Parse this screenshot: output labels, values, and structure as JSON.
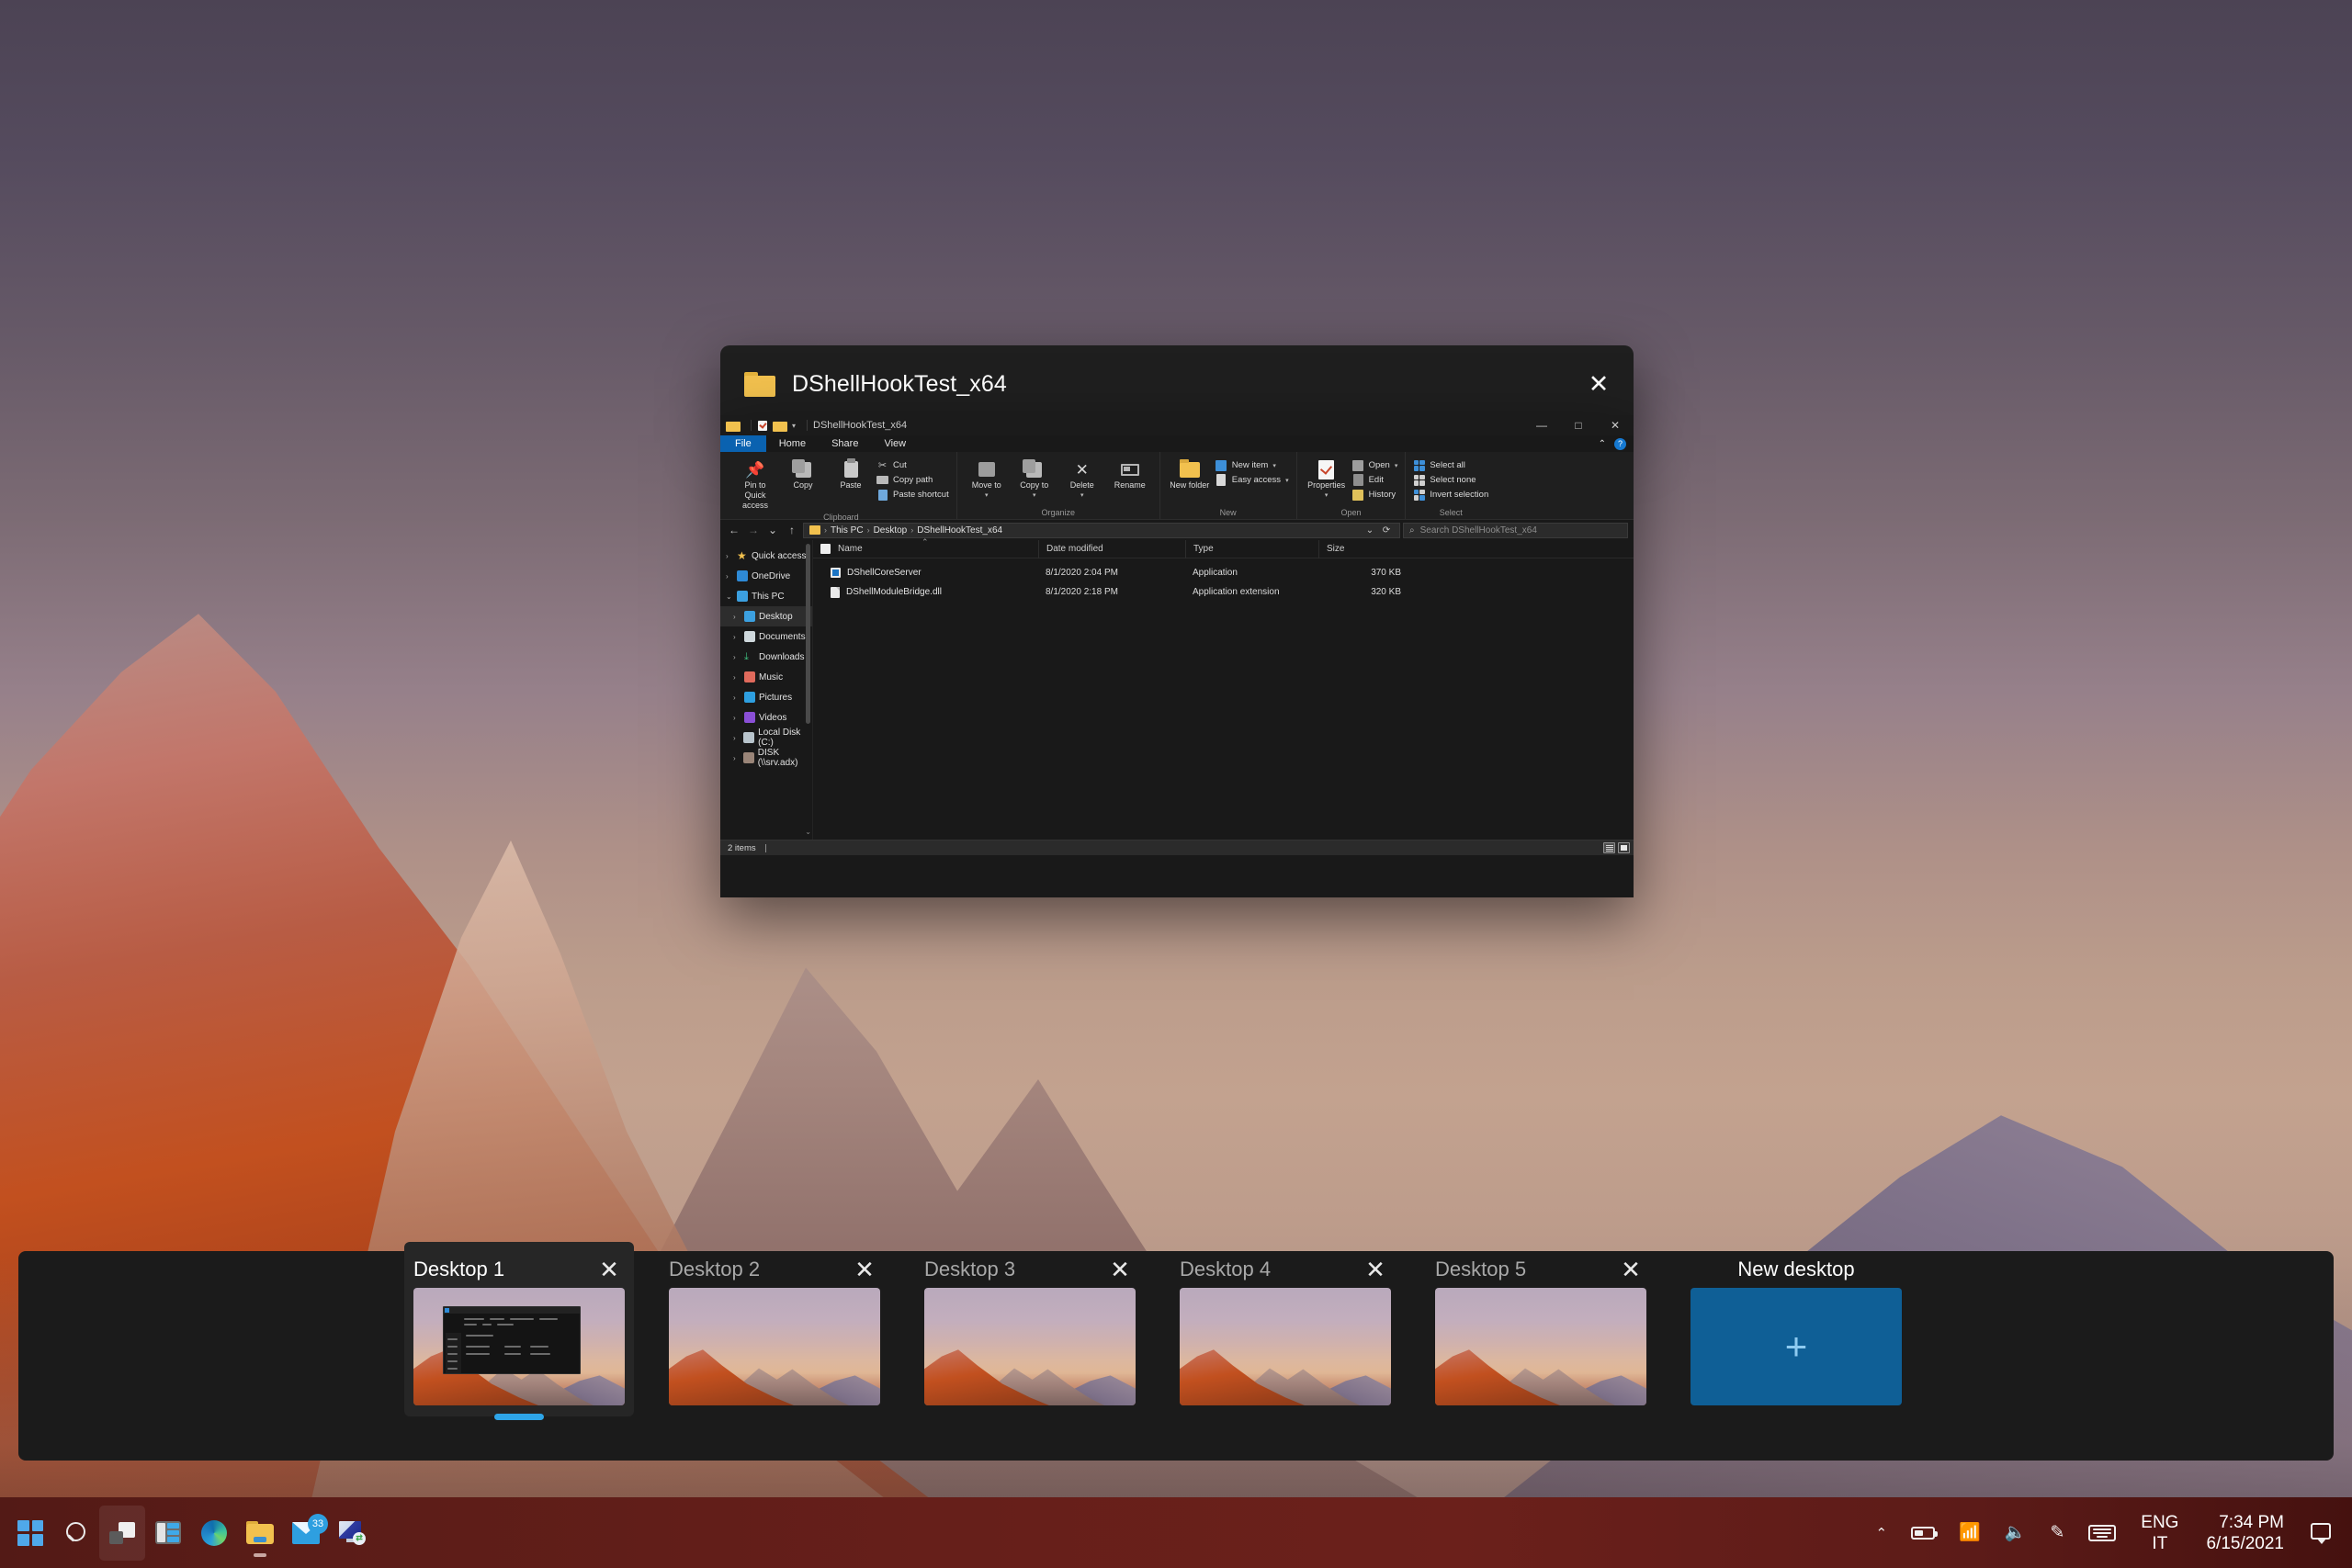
{
  "dialog": {
    "title": "DShellHookTest_x64",
    "folder_icon": "folder-icon",
    "close_icon": "close-icon"
  },
  "explorer": {
    "qat": {
      "title": "DShellHookTest_x64",
      "icons": [
        "folder-icon",
        "properties-check-icon",
        "new-folder-icon"
      ],
      "dropdown_caret": "▾",
      "minimize": "—",
      "maximize": "□",
      "close": "✕"
    },
    "ribbon_tabs": [
      {
        "label": "File",
        "active": true
      },
      {
        "label": "Home",
        "active": false
      },
      {
        "label": "Share",
        "active": false
      },
      {
        "label": "View",
        "active": false
      }
    ],
    "ribbon_collapse_icon": "chevron-up-icon",
    "ribbon_help_label": "?",
    "ribbon_groups": [
      {
        "name": "Clipboard",
        "big_buttons": [
          {
            "label": "Pin to Quick access",
            "icon": "pin-icon"
          },
          {
            "label": "Copy",
            "icon": "copy-icon"
          },
          {
            "label": "Paste",
            "icon": "paste-icon"
          }
        ],
        "small_buttons": [
          {
            "label": "Cut",
            "icon": "scissors-icon"
          },
          {
            "label": "Copy path",
            "icon": "copy-path-icon"
          },
          {
            "label": "Paste shortcut",
            "icon": "paste-shortcut-icon"
          }
        ]
      },
      {
        "name": "Organize",
        "big_buttons": [
          {
            "label": "Move to",
            "icon": "move-to-icon",
            "caret": "▾"
          },
          {
            "label": "Copy to",
            "icon": "copy-to-icon",
            "caret": "▾"
          },
          {
            "label": "Delete",
            "icon": "delete-icon",
            "caret": "▾"
          },
          {
            "label": "Rename",
            "icon": "rename-icon"
          }
        ],
        "small_buttons": []
      },
      {
        "name": "New",
        "big_buttons": [
          {
            "label": "New folder",
            "icon": "new-folder-icon"
          }
        ],
        "small_buttons": [
          {
            "label": "New item",
            "icon": "new-item-icon",
            "caret": "▾"
          },
          {
            "label": "Easy access",
            "icon": "easy-access-icon",
            "caret": "▾"
          }
        ]
      },
      {
        "name": "Open",
        "big_buttons": [
          {
            "label": "Properties",
            "icon": "properties-icon",
            "caret": "▾"
          }
        ],
        "small_buttons": [
          {
            "label": "Open",
            "icon": "open-icon",
            "caret": "▾"
          },
          {
            "label": "Edit",
            "icon": "edit-icon"
          },
          {
            "label": "History",
            "icon": "history-icon"
          }
        ]
      },
      {
        "name": "Select",
        "big_buttons": [],
        "small_buttons": [
          {
            "label": "Select all",
            "icon": "select-all-icon"
          },
          {
            "label": "Select none",
            "icon": "select-none-icon"
          },
          {
            "label": "Invert selection",
            "icon": "invert-selection-icon"
          }
        ]
      }
    ],
    "address_bar": {
      "back_icon": "←",
      "forward_icon": "→",
      "recent_icon": "⌄",
      "up_icon": "↑",
      "breadcrumbs": [
        "This PC",
        "Desktop",
        "DShellHookTest_x64"
      ],
      "dropdown_icon": "⌄",
      "refresh_icon": "⟳"
    },
    "search": {
      "placeholder": "Search DShellHookTest_x64",
      "icon": "search-icon"
    },
    "nav_pane": {
      "items": [
        {
          "label": "Quick access",
          "icon": "star-icon",
          "selected": false,
          "indent": 0
        },
        {
          "label": "OneDrive",
          "icon": "onedrive-icon",
          "selected": false,
          "indent": 0
        },
        {
          "label": "This PC",
          "icon": "this-pc-icon",
          "selected": false,
          "indent": 0,
          "expanded": true
        },
        {
          "label": "Desktop",
          "icon": "desktop-icon",
          "selected": true,
          "indent": 1
        },
        {
          "label": "Documents",
          "icon": "documents-icon",
          "selected": false,
          "indent": 1
        },
        {
          "label": "Downloads",
          "icon": "downloads-icon",
          "selected": false,
          "indent": 1
        },
        {
          "label": "Music",
          "icon": "music-icon",
          "selected": false,
          "indent": 1
        },
        {
          "label": "Pictures",
          "icon": "pictures-icon",
          "selected": false,
          "indent": 1
        },
        {
          "label": "Videos",
          "icon": "videos-icon",
          "selected": false,
          "indent": 1
        },
        {
          "label": "Local Disk (C:)",
          "icon": "disk-icon",
          "selected": false,
          "indent": 1
        },
        {
          "label": "DISK (\\\\srv.adx)",
          "icon": "network-drive-icon",
          "selected": false,
          "indent": 1
        }
      ]
    },
    "file_list": {
      "columns": [
        "Name",
        "Date modified",
        "Type",
        "Size"
      ],
      "sort_indicator": "chevron-up-icon",
      "rows": [
        {
          "name": "DShellCoreServer",
          "date": "8/1/2020 2:04 PM",
          "type": "Application",
          "size": "370 KB",
          "icon": "application-icon"
        },
        {
          "name": "DShellModuleBridge.dll",
          "date": "8/1/2020 2:18 PM",
          "type": "Application extension",
          "size": "320 KB",
          "icon": "dll-file-icon"
        }
      ]
    },
    "status_bar": {
      "item_count": "2 items",
      "view_details_icon": "details-view-icon",
      "view_tiles_icon": "tiles-view-icon"
    }
  },
  "task_view": {
    "desktops": [
      {
        "label": "Desktop 1",
        "active": true,
        "has_window": true,
        "close_icon": "close-icon"
      },
      {
        "label": "Desktop 2",
        "active": false,
        "has_window": false,
        "close_icon": "close-icon"
      },
      {
        "label": "Desktop 3",
        "active": false,
        "has_window": false,
        "close_icon": "close-icon"
      },
      {
        "label": "Desktop 4",
        "active": false,
        "has_window": false,
        "close_icon": "close-icon"
      },
      {
        "label": "Desktop 5",
        "active": false,
        "has_window": false,
        "close_icon": "close-icon"
      }
    ],
    "new_desktop": {
      "label": "New desktop",
      "plus_icon": "+"
    },
    "active_accent": "#2ea5e8"
  },
  "taskbar": {
    "buttons": [
      {
        "name": "start",
        "icon": "windows-start-icon"
      },
      {
        "name": "search",
        "icon": "search-icon"
      },
      {
        "name": "task-view",
        "icon": "task-view-icon"
      },
      {
        "name": "widgets",
        "icon": "widgets-icon"
      },
      {
        "name": "edge",
        "icon": "edge-browser-icon"
      },
      {
        "name": "file-explorer",
        "icon": "file-explorer-icon"
      },
      {
        "name": "mail",
        "icon": "mail-icon",
        "badge": "33"
      },
      {
        "name": "remote-desktop",
        "icon": "remote-desktop-icon"
      }
    ],
    "tray": {
      "chevron": "⌃",
      "battery_icon": "battery-icon",
      "wifi_icon": "wifi-icon",
      "volume_icon": "volume-icon",
      "pen_icon": "pen-icon",
      "keyboard_icon": "keyboard-icon",
      "language_primary": "ENG",
      "language_secondary": "IT",
      "time": "7:34 PM",
      "date": "6/15/2021",
      "notification_icon": "notification-icon"
    },
    "background_color": "#661f1a"
  }
}
